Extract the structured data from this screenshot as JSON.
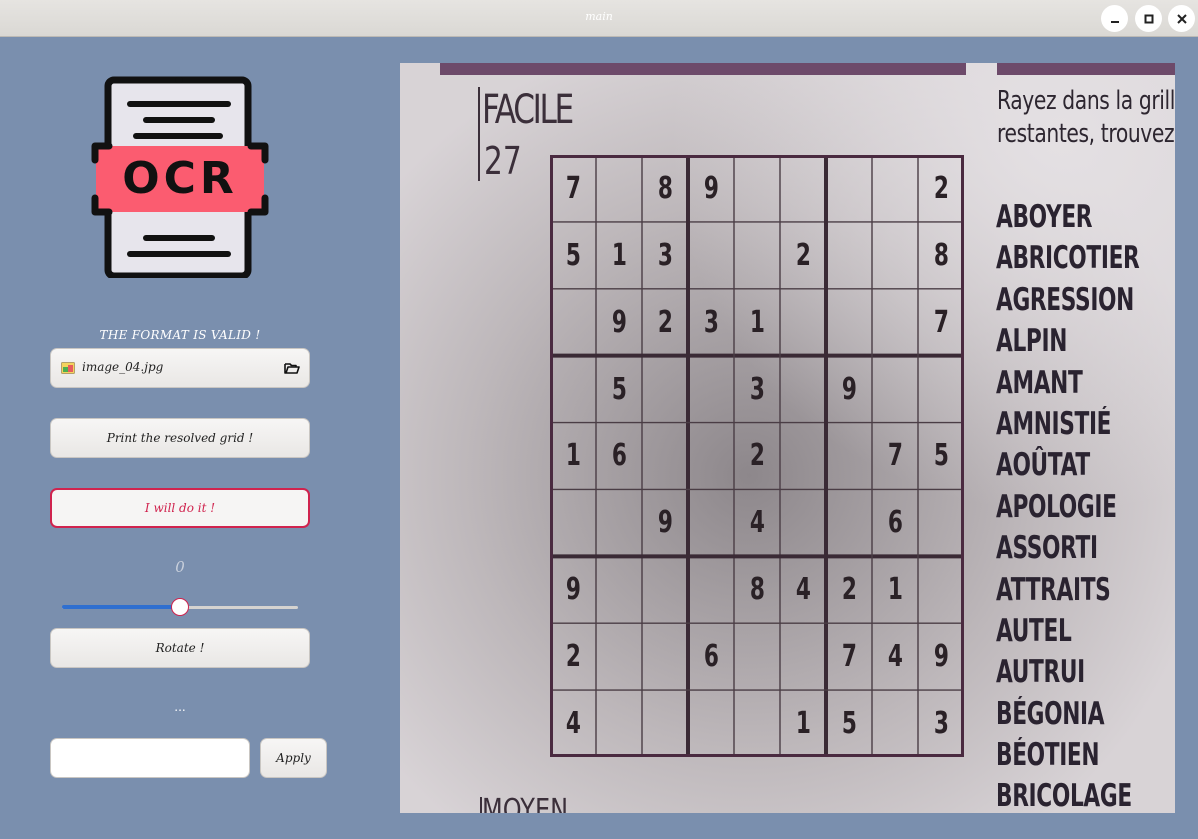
{
  "window": {
    "title": "main"
  },
  "sidebar": {
    "logo_text": "OCR",
    "status_text": "THE FORMAT IS VALID !",
    "file_chooser": {
      "filename": "image_04.jpg"
    },
    "print_button_label": "Print the resolved grid !",
    "solve_button_label": "I will do it !",
    "rotation_value_label": "0",
    "slider": {
      "value": 0,
      "min": -180,
      "max": 180,
      "fill_fraction": 0.5
    },
    "rotate_button_label": "Rotate !",
    "ellipsis_label": "...",
    "entry": {
      "value": "",
      "placeholder": ""
    },
    "apply_button_label": "Apply"
  },
  "image": {
    "heading": "FACILE",
    "puzzle_number": "27",
    "footer_heading": "MOYEN",
    "instruction_lines": [
      "Rayez dans la grille",
      "restantes, trouvez le"
    ],
    "sudoku": [
      [
        "7",
        "",
        "8",
        "9",
        "",
        "",
        "",
        "",
        "2"
      ],
      [
        "5",
        "1",
        "3",
        "",
        "",
        "2",
        "",
        "",
        "8"
      ],
      [
        "",
        "9",
        "2",
        "3",
        "1",
        "",
        "",
        "",
        "7"
      ],
      [
        "",
        "5",
        "",
        "",
        "3",
        "",
        "9",
        "",
        ""
      ],
      [
        "1",
        "6",
        "",
        "",
        "2",
        "",
        "",
        "7",
        "5"
      ],
      [
        "",
        "",
        "9",
        "",
        "4",
        "",
        "",
        "6",
        ""
      ],
      [
        "9",
        "",
        "",
        "",
        "8",
        "4",
        "2",
        "1",
        ""
      ],
      [
        "2",
        "",
        "",
        "6",
        "",
        "",
        "7",
        "4",
        "9"
      ],
      [
        "4",
        "",
        "",
        "",
        "",
        "1",
        "5",
        "",
        "3"
      ]
    ],
    "word_list": [
      "ABOYER",
      "ABRICOTIER",
      "AGRESSION",
      "ALPIN",
      "AMANT",
      "AMNISTIÉ",
      "AOÛTAT",
      "APOLOGIE",
      "ASSORTI",
      "ATTRAITS",
      "AUTEL",
      "AUTRUI",
      "BÉGONIA",
      "BÉOTIEN",
      "BRICOLAGE"
    ]
  },
  "colors": {
    "background": "#7a8fae",
    "accent": "#d0234e",
    "slider_fill": "#2f6fd0",
    "logo_red": "#fb5c70"
  }
}
